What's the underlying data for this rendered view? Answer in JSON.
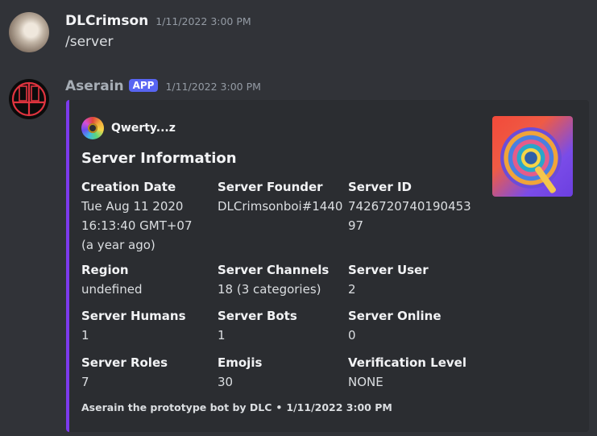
{
  "messages": [
    {
      "username": "DLCrimson",
      "timestamp": "1/11/2022 3:00 PM",
      "content": "/server"
    },
    {
      "username": "Aserain",
      "badge": "APP",
      "timestamp": "1/11/2022 3:00 PM"
    }
  ],
  "embed": {
    "accent_color": "#7c3aed",
    "author": "Qwerty...z",
    "title": "Server Information",
    "fields": [
      {
        "name": "Creation Date",
        "value": "Tue Aug 11 2020 16:13:40 GMT+07 (a year ago)"
      },
      {
        "name": "Server Founder",
        "value": "DLCrimsonboi#1440"
      },
      {
        "name": "Server ID",
        "value": "742672074019045397"
      },
      {
        "name": "Region",
        "value": "undefined"
      },
      {
        "name": "Server Channels",
        "value": "18 (3 categories)"
      },
      {
        "name": "Server User",
        "value": "2"
      },
      {
        "name": "Server Humans",
        "value": "1"
      },
      {
        "name": "Server Bots",
        "value": "1"
      },
      {
        "name": "Server Online",
        "value": "0"
      },
      {
        "name": "Server Roles",
        "value": "7"
      },
      {
        "name": "Emojis",
        "value": "30"
      },
      {
        "name": "Verification Level",
        "value": "NONE"
      }
    ],
    "footer_text": "Aserain the prototype bot by DLC",
    "footer_separator": "•",
    "footer_timestamp": "1/11/2022 3:00 PM"
  }
}
